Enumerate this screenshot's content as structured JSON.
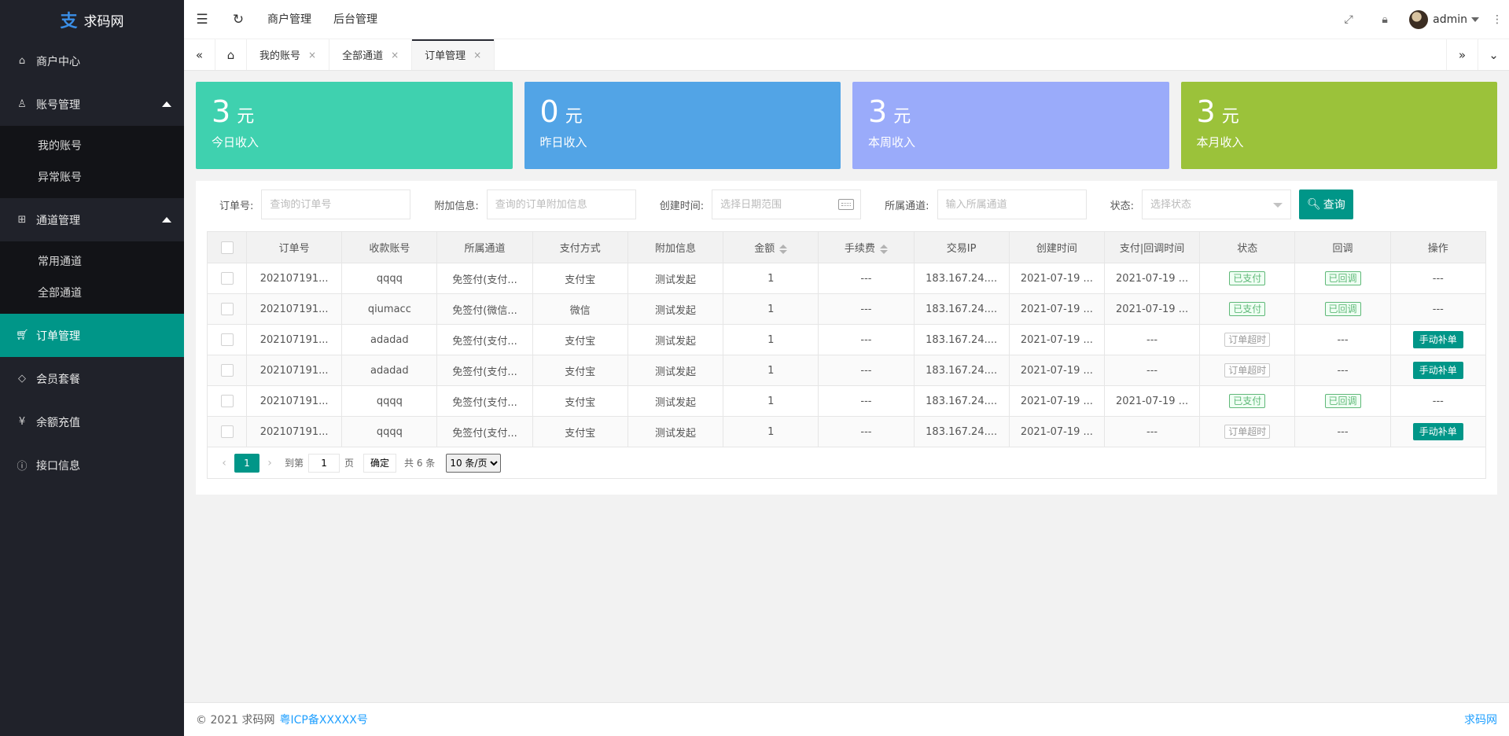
{
  "app": {
    "logo_mark": "支",
    "name": "求码网"
  },
  "sidebar": {
    "items": [
      {
        "label": "商户中心",
        "icon": "home-icon"
      },
      {
        "label": "账号管理",
        "icon": "user-icon",
        "sub": [
          {
            "label": "我的账号"
          },
          {
            "label": "异常账号"
          }
        ]
      },
      {
        "label": "通道管理",
        "icon": "channel-icon",
        "sub": [
          {
            "label": "常用通道"
          },
          {
            "label": "全部通道"
          }
        ]
      },
      {
        "label": "订单管理",
        "icon": "cart-icon",
        "active": true
      },
      {
        "label": "会员套餐",
        "icon": "diamond-icon"
      },
      {
        "label": "余额充值",
        "icon": "yen-icon"
      },
      {
        "label": "接口信息",
        "icon": "info-icon"
      }
    ]
  },
  "header": {
    "links": [
      "商户管理",
      "后台管理"
    ],
    "user": "admin"
  },
  "tabs": [
    {
      "label": "我的账号"
    },
    {
      "label": "全部通道"
    },
    {
      "label": "订单管理",
      "active": true
    }
  ],
  "cards": [
    {
      "value": "3",
      "unit": "元",
      "label": "今日收入",
      "color": "#3fd1af"
    },
    {
      "value": "0",
      "unit": "元",
      "label": "昨日收入",
      "color": "#52a4e6"
    },
    {
      "value": "3",
      "unit": "元",
      "label": "本周收入",
      "color": "#9aabfa"
    },
    {
      "value": "3",
      "unit": "元",
      "label": "本月收入",
      "color": "#9bc23a"
    }
  ],
  "filters": {
    "order_no": {
      "label": "订单号:",
      "placeholder": "查询的订单号"
    },
    "attach": {
      "label": "附加信息:",
      "placeholder": "查询的订单附加信息"
    },
    "created": {
      "label": "创建时间:",
      "placeholder": "选择日期范围"
    },
    "channel": {
      "label": "所属通道:",
      "placeholder": "输入所属通道"
    },
    "status": {
      "label": "状态:",
      "placeholder": "选择状态"
    },
    "search_label": "查询"
  },
  "table": {
    "columns": [
      "订单号",
      "收款账号",
      "所属通道",
      "支付方式",
      "附加信息",
      "金额",
      "手续费",
      "交易IP",
      "创建时间",
      "支付|回调时间",
      "状态",
      "回调",
      "操作"
    ],
    "rows": [
      {
        "order": "202107191...",
        "account": "qqqq",
        "channel": "免签付(支付...",
        "method": "支付宝",
        "attach": "测试发起",
        "amount": "1",
        "fee": "---",
        "ip": "183.167.24....",
        "created": "2021-07-19 ...",
        "paid": "2021-07-19 ...",
        "status": "已支付",
        "status_type": "green",
        "callback": "已回调",
        "callback_type": "green",
        "op": "---"
      },
      {
        "order": "202107191...",
        "account": "qiumacc",
        "channel": "免签付(微信...",
        "method": "微信",
        "attach": "测试发起",
        "amount": "1",
        "fee": "---",
        "ip": "183.167.24....",
        "created": "2021-07-19 ...",
        "paid": "2021-07-19 ...",
        "status": "已支付",
        "status_type": "green",
        "callback": "已回调",
        "callback_type": "green",
        "op": "---"
      },
      {
        "order": "202107191...",
        "account": "adadad",
        "channel": "免签付(支付...",
        "method": "支付宝",
        "attach": "测试发起",
        "amount": "1",
        "fee": "---",
        "ip": "183.167.24....",
        "created": "2021-07-19 ...",
        "paid": "---",
        "status": "订单超时",
        "status_type": "gray",
        "callback": "---",
        "callback_type": "",
        "op": "手动补单"
      },
      {
        "order": "202107191...",
        "account": "adadad",
        "channel": "免签付(支付...",
        "method": "支付宝",
        "attach": "测试发起",
        "amount": "1",
        "fee": "---",
        "ip": "183.167.24....",
        "created": "2021-07-19 ...",
        "paid": "---",
        "status": "订单超时",
        "status_type": "gray",
        "callback": "---",
        "callback_type": "",
        "op": "手动补单"
      },
      {
        "order": "202107191...",
        "account": "qqqq",
        "channel": "免签付(支付...",
        "method": "支付宝",
        "attach": "测试发起",
        "amount": "1",
        "fee": "---",
        "ip": "183.167.24....",
        "created": "2021-07-19 ...",
        "paid": "2021-07-19 ...",
        "status": "已支付",
        "status_type": "green",
        "callback": "已回调",
        "callback_type": "green",
        "op": "---"
      },
      {
        "order": "202107191...",
        "account": "qqqq",
        "channel": "免签付(支付...",
        "method": "支付宝",
        "attach": "测试发起",
        "amount": "1",
        "fee": "---",
        "ip": "183.167.24....",
        "created": "2021-07-19 ...",
        "paid": "---",
        "status": "订单超时",
        "status_type": "gray",
        "callback": "---",
        "callback_type": "",
        "op": "手动补单"
      }
    ]
  },
  "pager": {
    "current": "1",
    "goto_label": "到第",
    "page_unit": "页",
    "goto_value": "1",
    "confirm": "确定",
    "total": "共 6 条",
    "page_size": "10 条/页"
  },
  "footer": {
    "copyright": "© 2021 求码网",
    "icp": "粤ICP备XXXXX号",
    "right": "求码网"
  },
  "colors": {
    "accent": "#009688",
    "sidebar_bg": "#20222a"
  }
}
